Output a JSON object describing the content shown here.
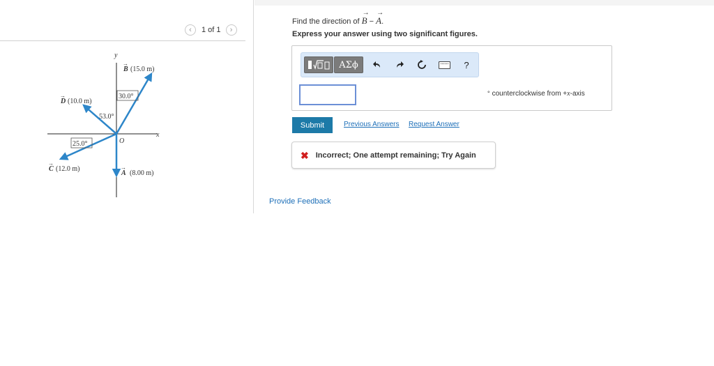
{
  "pager": {
    "prev_icon": "chevron-left-icon",
    "label": "1 of 1",
    "next_icon": "chevron-right-icon"
  },
  "diagram": {
    "axis_y": "y",
    "axis_x": "x",
    "origin": "O",
    "vec_b": {
      "letter": "B",
      "value": "(15.0 m)"
    },
    "vec_d": {
      "letter": "D",
      "value": "(10.0 m)"
    },
    "vec_c": {
      "letter": "C",
      "value": "(12.0 m)"
    },
    "vec_a": {
      "letter": "A",
      "value": "(8.00 m)"
    },
    "angle_b": "30.0°",
    "angle_d": "53.0°",
    "angle_c": "25.0°",
    "vector_color": "#2d86c9"
  },
  "question": {
    "prefix": "Find the direction of ",
    "vec1": "B",
    "minus": " − ",
    "vec2": "A",
    "suffix": ".",
    "instruction": "Express your answer using two significant figures."
  },
  "toolbar": {
    "templates_icon": "templates-icon",
    "symbols_label": "ΑΣϕ",
    "undo_icon": "undo-icon",
    "redo_icon": "redo-icon",
    "reset_icon": "reset-icon",
    "keyboard_icon": "keyboard-icon",
    "help_label": "?"
  },
  "answer": {
    "value": "",
    "unit_deg": "°",
    "unit_text": "counterclockwise from +",
    "unit_var": "x",
    "unit_tail": "-axis"
  },
  "actions": {
    "submit_label": "Submit",
    "previous_answers_label": "Previous Answers",
    "request_answer_label": "Request Answer"
  },
  "feedback": {
    "icon": "x-icon",
    "message": "Incorrect; One attempt remaining; Try Again",
    "color": "#d11f1f"
  },
  "footer": {
    "provide_feedback_label": "Provide Feedback"
  },
  "colors": {
    "accent": "#1d7aa8",
    "link": "#1d6fb8",
    "toolbar_bg": "#dbe9f9"
  }
}
